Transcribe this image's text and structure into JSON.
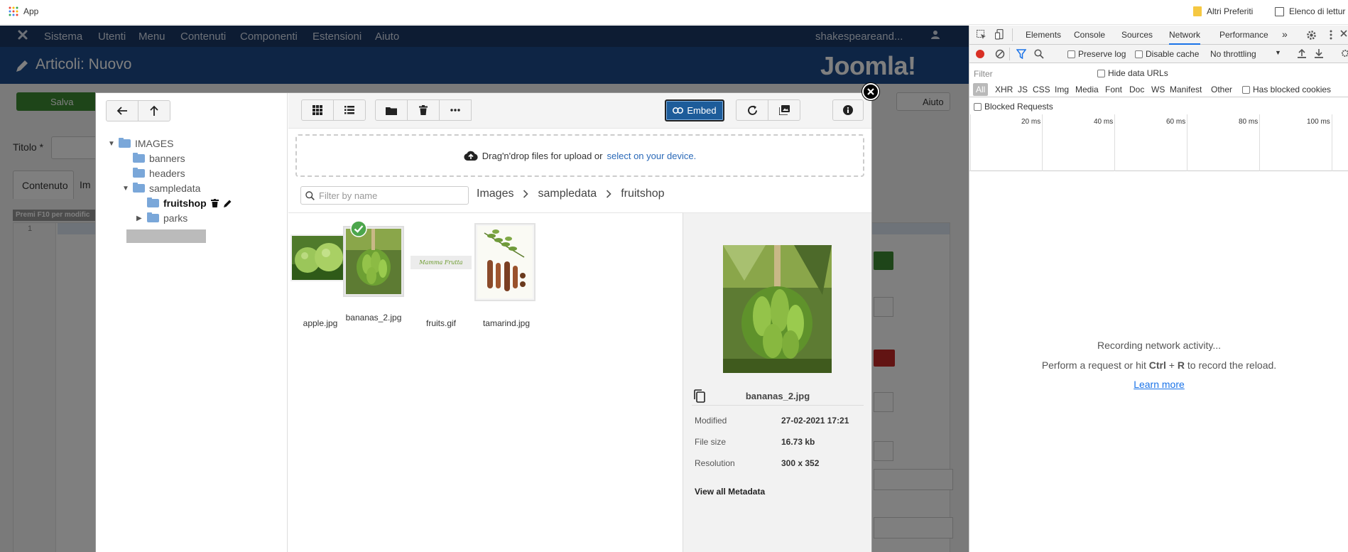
{
  "bookmarks": {
    "app_label": "App",
    "other_favorites": "Altri Preferiti",
    "reading_list": "Elenco di lettur"
  },
  "joomla": {
    "menu": [
      "Sistema",
      "Utenti",
      "Menu",
      "Contenuti",
      "Componenti",
      "Estensioni",
      "Aiuto"
    ],
    "site_name": "shakespeareand...",
    "page_title": "Articoli: Nuovo",
    "logo_text": "Joomla!",
    "save_label": "Salva",
    "help_label": "Aiuto",
    "title_label": "Titolo *",
    "tab_content": "Contenuto",
    "tab_images": "Im",
    "f10_hint": "Premi F10 per modific",
    "line_number": "1"
  },
  "media": {
    "tree": {
      "root": "IMAGES",
      "items": [
        "banners",
        "headers",
        "sampledata",
        "fruitshop",
        "parks"
      ]
    },
    "embed_label": "Embed",
    "dropzone_text": "Drag'n'drop files for upload or",
    "dropzone_link": "select on your device.",
    "filter_placeholder": "Filter by name",
    "breadcrumb": [
      "Images",
      "sampledata",
      "fruitshop"
    ],
    "files": [
      {
        "name": "apple.jpg"
      },
      {
        "name": "bananas_2.jpg",
        "selected": true
      },
      {
        "name": "fruits.gif"
      },
      {
        "name": "tamarind.jpg"
      }
    ],
    "fruits_gif_text": "Mamma Frutta",
    "preview": {
      "filename": "bananas_2.jpg",
      "modified_label": "Modified",
      "modified_value": "27-02-2021 17:21",
      "size_label": "File size",
      "size_value": "16.73 kb",
      "resolution_label": "Resolution",
      "resolution_value": "300 x 352",
      "metadata_link": "View all Metadata"
    }
  },
  "devtools": {
    "tabs": [
      "Elements",
      "Console",
      "Sources",
      "Network",
      "Performance"
    ],
    "active_tab": "Network",
    "more_tabs": "»",
    "preserve_log": "Preserve log",
    "disable_cache": "Disable cache",
    "throttling": "No throttling",
    "filter_placeholder": "Filter",
    "hide_data_urls": "Hide data URLs",
    "types": [
      "All",
      "XHR",
      "JS",
      "CSS",
      "Img",
      "Media",
      "Font",
      "Doc",
      "WS",
      "Manifest",
      "Other"
    ],
    "has_blocked_cookies": "Has blocked cookies",
    "blocked_requests": "Blocked Requests",
    "timeline_ticks": [
      "20 ms",
      "40 ms",
      "60 ms",
      "80 ms",
      "100 ms"
    ],
    "recording": "Recording network activity...",
    "hint_prefix": "Perform a request or hit",
    "hint_key1": "Ctrl",
    "hint_plus": "+",
    "hint_key2": "R",
    "hint_suffix": "to record the reload.",
    "learn_more": "Learn more"
  },
  "colors": {
    "joomla_nav": "#1a3867",
    "joomla_header": "#1d4b8a",
    "embed_button": "#1d5c9a",
    "devtools_accent": "#1a73e8",
    "record_red": "#d93025"
  }
}
